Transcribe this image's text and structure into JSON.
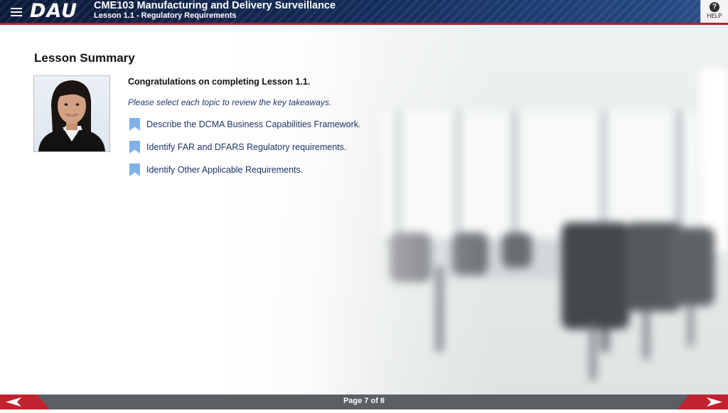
{
  "header": {
    "menu_icon": "hamburger-menu-icon",
    "logo": "DAU",
    "course_title": "CME103 Manufacturing and Delivery Surveillance",
    "lesson_title": "Lesson 1.1 - Regulatory Requirements",
    "help_label": "HELP",
    "help_icon": "question-icon",
    "accent_color": "#b3202c"
  },
  "main": {
    "heading": "Lesson Summary",
    "portrait_icon": "instructor-portrait",
    "congrats": "Congratulations on completing Lesson 1.1.",
    "instruction": "Please select each topic to review the key takeaways.",
    "topics": [
      {
        "label": "Describe the DCMA Business Capabilities Framework.",
        "icon": "bookmark-icon"
      },
      {
        "label": "Identify FAR and DFARS Regulatory requirements.",
        "icon": "bookmark-icon"
      },
      {
        "label": "Identify Other Applicable Requirements.",
        "icon": "bookmark-icon"
      }
    ],
    "bookmark_color": "#7fb2ea"
  },
  "footer": {
    "page_indicator": "Page 7 of 8",
    "prev_icon": "arrow-left-icon",
    "next_icon": "arrow-right-icon",
    "nav_color": "#c1222f"
  }
}
